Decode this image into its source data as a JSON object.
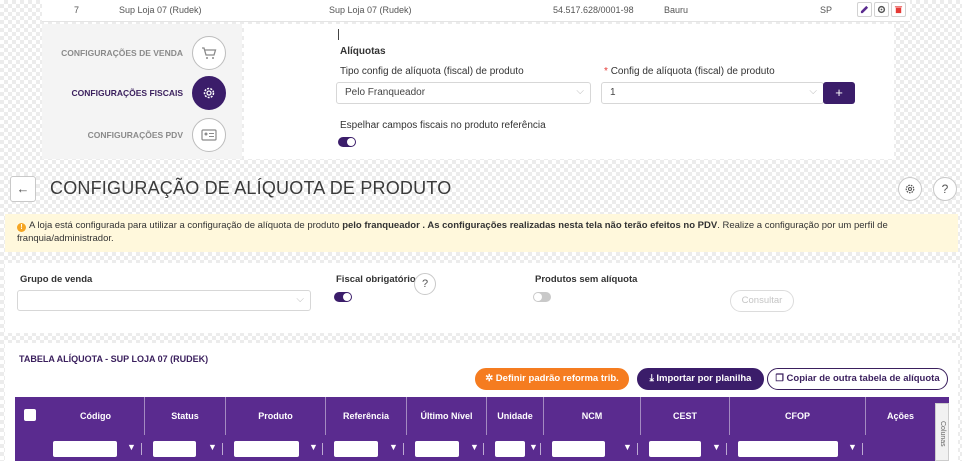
{
  "top_row": {
    "code": "7",
    "name": "Sup Loja 07 (Rudek)",
    "fantasy": "Sup Loja 07 (Rudek)",
    "cnpj": "54.517.628/0001-98",
    "city": "Bauru",
    "uf": "SP"
  },
  "config_nav": {
    "items": [
      {
        "label": "CONFIGURAÇÕES DE VENDA",
        "icon": "cart-icon"
      },
      {
        "label": "CONFIGURAÇÕES FISCAIS",
        "icon": "gear-icon"
      },
      {
        "label": "CONFIGURAÇÕES PDV",
        "icon": "id-card-icon"
      }
    ]
  },
  "aliquotas": {
    "section_title": "Alíquotas",
    "tipo_label": "Tipo config de alíquota (fiscal) de produto",
    "tipo_value": "Pelo Franqueador",
    "config_label": "Config de alíquota (fiscal) de produto",
    "config_value": "1",
    "required_mark": "*",
    "add_label": "+",
    "espelhar_label": "Espelhar campos fiscais no produto referência"
  },
  "header": {
    "back_label": "←",
    "title": "CONFIGURAÇÃO DE ALÍQUOTA DE PRODUTO",
    "help_label": "?"
  },
  "alert": {
    "icon_label": "!",
    "text_1": "A loja está configurada para utilizar a configuração de alíquota de produto ",
    "text_bold": "pelo franqueador . As configurações realizadas nesta tela não terão efeitos no PDV",
    "text_2": ". Realize a configuração por um perfil de franquia/administrador."
  },
  "filters": {
    "grupo_label": "Grupo de venda",
    "fiscal_label": "Fiscal obrigatório",
    "help_label": "?",
    "sem_aliquota_label": "Produtos sem alíquota",
    "consultar_label": "Consultar"
  },
  "table_section": {
    "title": "TABELA ALÍQUOTA - SUP LOJA 07 (RUDEK)",
    "btn_reforma": "Definir padrão reforma trib.",
    "btn_importar": "Importar por planilha",
    "btn_copiar": "Copiar de outra tabela de alíquota",
    "columns": [
      "Código",
      "Status",
      "Produto",
      "Referência",
      "Último Nível",
      "Unidade",
      "NCM",
      "CEST",
      "CFOP",
      "Ações"
    ],
    "colunas_label": "Colunas"
  },
  "colors": {
    "primary": "#3b1d6a",
    "table_header": "#5a2b8f",
    "orange": "#f57c20",
    "alert_bg": "#fff8dc"
  }
}
